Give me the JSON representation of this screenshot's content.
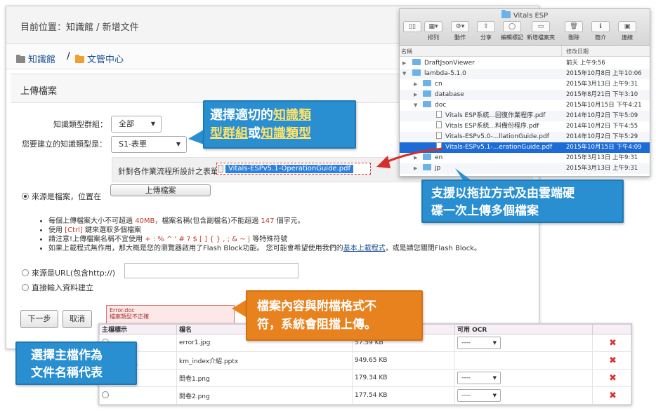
{
  "main": {
    "breadcrumb": "目前位置：知識館 / 新增文件",
    "nav": {
      "item1": "知識館",
      "sep": "/",
      "item2": "文管中心"
    },
    "section_title": "上傳檔案",
    "group_label": "知識類型群組：",
    "group_value": "全部",
    "type_label": "您要建立的知識類型是：",
    "type_value": "S1-表單",
    "type_description": "針對各作業流程所設計之表單,表",
    "source_file_label": "來源是檔案，位置在",
    "upload_button": "上傳檔案",
    "notes": {
      "n1_a": "每個上傳檔案大小不可超過 ",
      "n1_size": "40MB",
      "n1_b": "，檔案名稱(包含副檔名)不能超過 ",
      "n1_len": "147",
      "n1_c": " 個字元。",
      "n2_a": "使用 ",
      "n2_key": "[Ctrl]",
      "n2_b": " 鍵來選取多個檔案",
      "n3_a": "請注意!上傳檔案名稱不宜使用 ",
      "n3_chars": "+ : % ^ ' # ? $ [ ] { } , ; & ~ |",
      "n3_b": " 等特殊符號",
      "n4_a": "如果上載程式無作用，那大概是您的瀏覽器啟用了Flash Block功能。 您可能會希望使用我們的",
      "n4_link": "基本上載程式",
      "n4_b": "，或是請您關閉Flash Block。"
    },
    "source_url_label": "來源是URL(包含http://)",
    "direct_label": "直接輸入資料建立",
    "next_button": "下一步",
    "cancel_button": "取消",
    "error_file": "Error.doc",
    "error_msg": "檔案類型不正確"
  },
  "table": {
    "headers": [
      "主檔標示",
      "檔名",
      "",
      "可用 OCR",
      ""
    ],
    "rows": [
      {
        "name": "error1.jpg",
        "size": "57.59 KB",
        "ocr": "----"
      },
      {
        "name": "km_index介紹.pptx",
        "size": "949.65 KB",
        "ocr": ""
      },
      {
        "name": "問卷1.png",
        "size": "179.34 KB",
        "ocr": "----"
      },
      {
        "name": "問卷2.png",
        "size": "177.54 KB",
        "ocr": "----"
      }
    ]
  },
  "finder": {
    "title": "Vitals ESP",
    "toolbar": [
      "排列",
      "動作",
      "分享",
      "編輯標記",
      "新增檔案夾",
      "刪除",
      "簡介",
      "連線"
    ],
    "col_name": "名稱",
    "col_date": "修改日期",
    "rows": [
      {
        "name": "DraftJsonViewer",
        "date": "前天 上午9:56"
      },
      {
        "name": "lambda-5.1.0",
        "date": "2015年10月8日 上午10:06"
      },
      {
        "name": "cn",
        "date": "2015年3月13日 上午9:31"
      },
      {
        "name": "database",
        "date": "2015年8月21日 下午3:10"
      },
      {
        "name": "doc",
        "date": "2015年10月15日 下午4:21"
      },
      {
        "name": "Vitals ESP系統...回復作業程序.pdf",
        "date": "2014年10月2日 下午5:09"
      },
      {
        "name": "Vitals ESP系統...料備份程序.pdf",
        "date": "2014年10月2日 下午4:55"
      },
      {
        "name": "Vitals-ESPv5.0-...llationGuide.pdf",
        "date": "2014年10月2日 下午5:29"
      },
      {
        "name": "Vitals-ESPv5.1-...erationGuide.pdf",
        "date": "2015年10月15日 下午4:09"
      },
      {
        "name": "en",
        "date": "2015年3月13日 上午9:31"
      },
      {
        "name": "jp",
        "date": "2015年3月13日 上午9:31"
      }
    ]
  },
  "dragged_file": "Vitals-ESPv5.1-OperationGuide.pdf",
  "callouts": {
    "top_line1_a": "選擇",
    "top_line1_b": "適切的",
    "top_line1_c": "知識類",
    "top_line2_a": "型群組",
    "top_line2_b": "或",
    "top_line2_c": "知識類型",
    "drag_line1": "支援以拖拉方式及由雲端硬",
    "drag_line2": "碟一次上傳多個檔案",
    "error_line1": "檔案內容與附檔格式不",
    "error_line2": "符，系統會阻擋上傳。",
    "main_line1": "選擇主檔作為",
    "main_line2": "文件名稱代表"
  },
  "colors": {
    "blue_callout": "#2a8fd0",
    "orange_callout": "#e8821e",
    "selection": "#1c6bd6"
  }
}
